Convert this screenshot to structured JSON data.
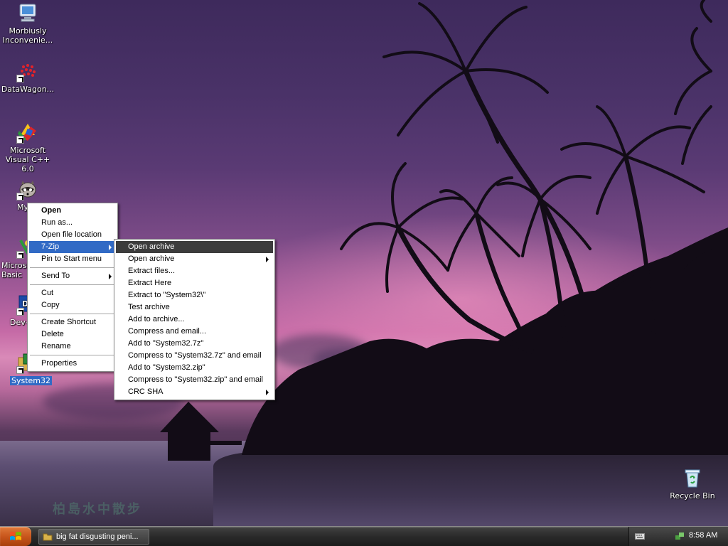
{
  "desktop": {
    "icons": [
      {
        "label": "Morbiusly Inconvenie...",
        "icon": "computer-icon"
      },
      {
        "label": "DataWagon...",
        "icon": "datawagon-icon"
      },
      {
        "label": "Microsoft Visual C++ 6.0",
        "icon": "visual-cpp-icon"
      },
      {
        "label": "My",
        "icon": "raccoon-icon"
      },
      {
        "label": "Microso Basic",
        "icon": "visual-basic-icon"
      },
      {
        "label": "Dev-",
        "icon": "dev-cpp-icon"
      },
      {
        "label": "System32",
        "icon": "folder-shortcut-icon"
      },
      {
        "label": "Recycle Bin",
        "icon": "recycle-bin-icon"
      }
    ],
    "wallpaper_watermark": "柏島水中散步"
  },
  "context_menu": {
    "items": [
      {
        "label": "Open",
        "bold": true
      },
      {
        "label": "Run as..."
      },
      {
        "label": "Open file location"
      },
      {
        "label": "7-Zip",
        "submenu": true,
        "highlighted": true
      },
      {
        "label": "Pin to Start menu"
      },
      {
        "label": "Send To",
        "submenu": true
      },
      {
        "label": "Cut"
      },
      {
        "label": "Copy"
      },
      {
        "label": "Create Shortcut"
      },
      {
        "label": "Delete"
      },
      {
        "label": "Rename"
      },
      {
        "label": "Properties"
      }
    ]
  },
  "zip_submenu": {
    "items": [
      {
        "label": "Open archive",
        "highlighted": true
      },
      {
        "label": "Open archive",
        "submenu": true
      },
      {
        "label": "Extract files..."
      },
      {
        "label": "Extract Here"
      },
      {
        "label": "Extract to \"System32\\\""
      },
      {
        "label": "Test archive"
      },
      {
        "label": "Add to archive..."
      },
      {
        "label": "Compress and email..."
      },
      {
        "label": "Add to \"System32.7z\""
      },
      {
        "label": "Compress to \"System32.7z\" and email"
      },
      {
        "label": "Add to \"System32.zip\""
      },
      {
        "label": "Compress to \"System32.zip\" and email"
      },
      {
        "label": "CRC SHA",
        "submenu": true
      }
    ]
  },
  "taskbar": {
    "start_icon": "windows-logo-icon",
    "task_button": "big fat disgusting peni...",
    "clock": "8:58 AM"
  },
  "colors": {
    "highlight": "#316ac5",
    "submenu_highlight": "#3c3c3c",
    "start_button": "#c8561c"
  }
}
